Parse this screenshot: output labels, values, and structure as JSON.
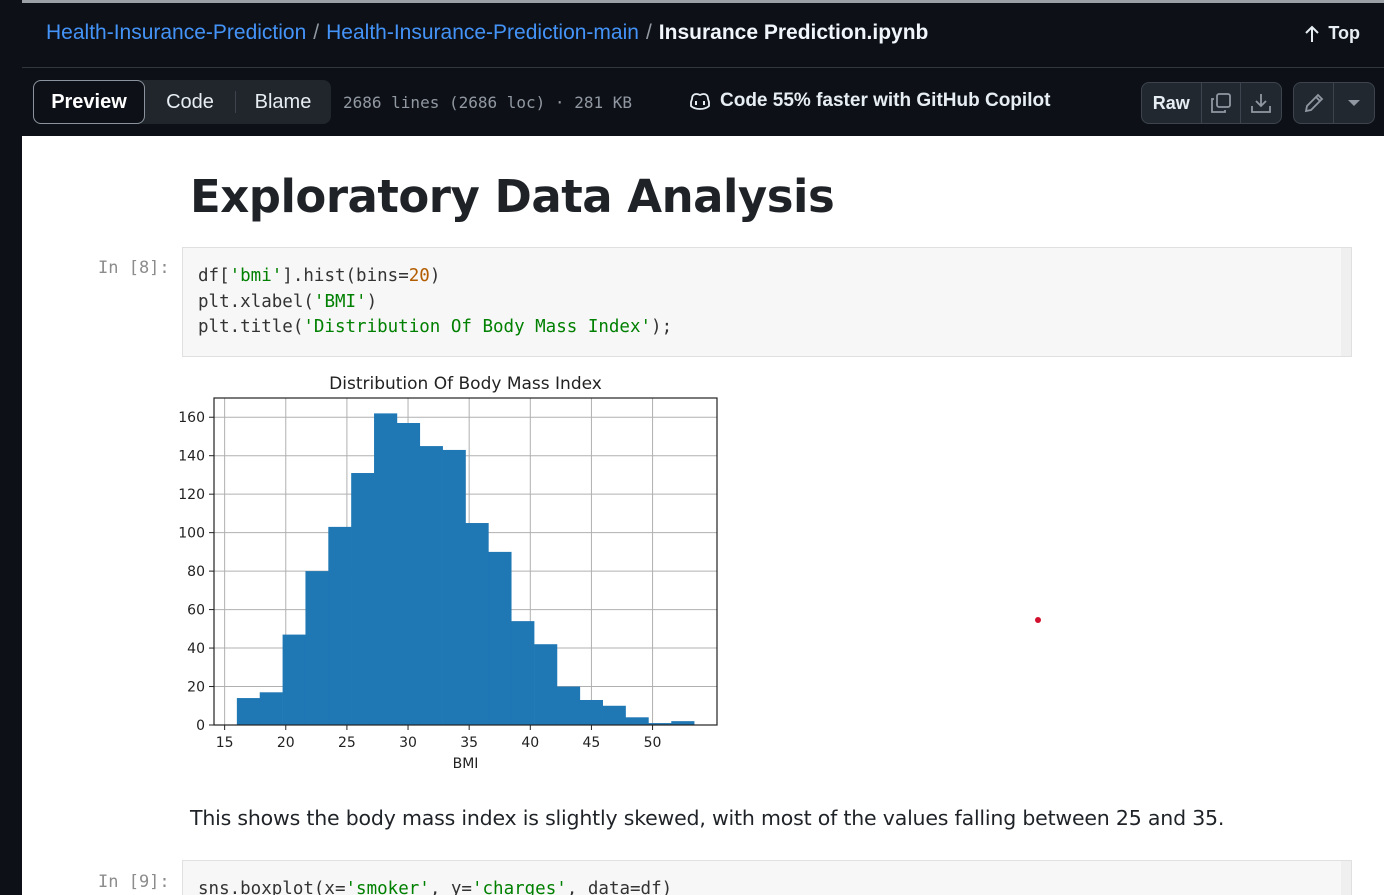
{
  "breadcrumb": {
    "repo": "Health-Insurance-Prediction",
    "folder": "Health-Insurance-Prediction-main",
    "file": "Insurance Prediction.ipynb",
    "separator": "/"
  },
  "top_link": "Top",
  "toolbar": {
    "tabs": [
      {
        "label": "Preview",
        "active": true
      },
      {
        "label": "Code",
        "active": false
      },
      {
        "label": "Blame",
        "active": false
      }
    ],
    "file_info": "2686 lines (2686 loc) · 281 KB",
    "copilot_text": "Code 55% faster with GitHub Copilot",
    "raw_label": "Raw",
    "icons": [
      "copy-icon",
      "download-icon",
      "pencil-icon",
      "triangle-down-icon"
    ]
  },
  "notebook": {
    "heading": "Exploratory Data Analysis",
    "cell8": {
      "prompt": "In [8]:",
      "lines": [
        [
          {
            "t": "df[",
            "c": "p"
          },
          {
            "t": "'bmi'",
            "c": "s"
          },
          {
            "t": "].hist(bins=",
            "c": "p"
          },
          {
            "t": "20",
            "c": "n"
          },
          {
            "t": ")",
            "c": "p"
          }
        ],
        [
          {
            "t": "plt.xlabel(",
            "c": "p"
          },
          {
            "t": "'BMI'",
            "c": "s"
          },
          {
            "t": ")",
            "c": "p"
          }
        ],
        [
          {
            "t": "plt.title(",
            "c": "p"
          },
          {
            "t": "'Distribution Of Body Mass Index'",
            "c": "s"
          },
          {
            "t": ");",
            "c": "p"
          }
        ]
      ]
    },
    "explanation": "This shows the body mass index is slightly skewed, with most of the values falling between 25 and 35.",
    "cell9": {
      "prompt": "In [9]:",
      "lines": [
        [
          {
            "t": "sns.boxplot(x=",
            "c": "p"
          },
          {
            "t": "'smoker'",
            "c": "s"
          },
          {
            "t": ", y=",
            "c": "p"
          },
          {
            "t": "'charges'",
            "c": "s"
          },
          {
            "t": ", data=df)",
            "c": "p"
          }
        ]
      ]
    }
  },
  "chart_data": {
    "type": "bar",
    "title": "Distribution Of Body Mass Index",
    "xlabel": "BMI",
    "ylabel": "",
    "bin_edges": [
      16.0,
      17.87,
      19.74,
      21.61,
      23.48,
      25.35,
      27.22,
      29.09,
      30.96,
      32.83,
      34.7,
      36.57,
      38.44,
      40.31,
      42.18,
      44.05,
      45.92,
      47.79,
      49.66,
      51.53,
      53.4
    ],
    "values": [
      14,
      17,
      47,
      80,
      103,
      131,
      162,
      157,
      145,
      143,
      105,
      90,
      54,
      42,
      20,
      13,
      10,
      4,
      1,
      2
    ],
    "xlim": [
      14.13,
      55.27
    ],
    "ylim": [
      0,
      170
    ],
    "xticks": [
      15,
      20,
      25,
      30,
      35,
      40,
      45,
      50
    ],
    "yticks": [
      0,
      20,
      40,
      60,
      80,
      100,
      120,
      140,
      160
    ],
    "bar_color": "#1f77b4",
    "grid": true,
    "legend": "none"
  }
}
